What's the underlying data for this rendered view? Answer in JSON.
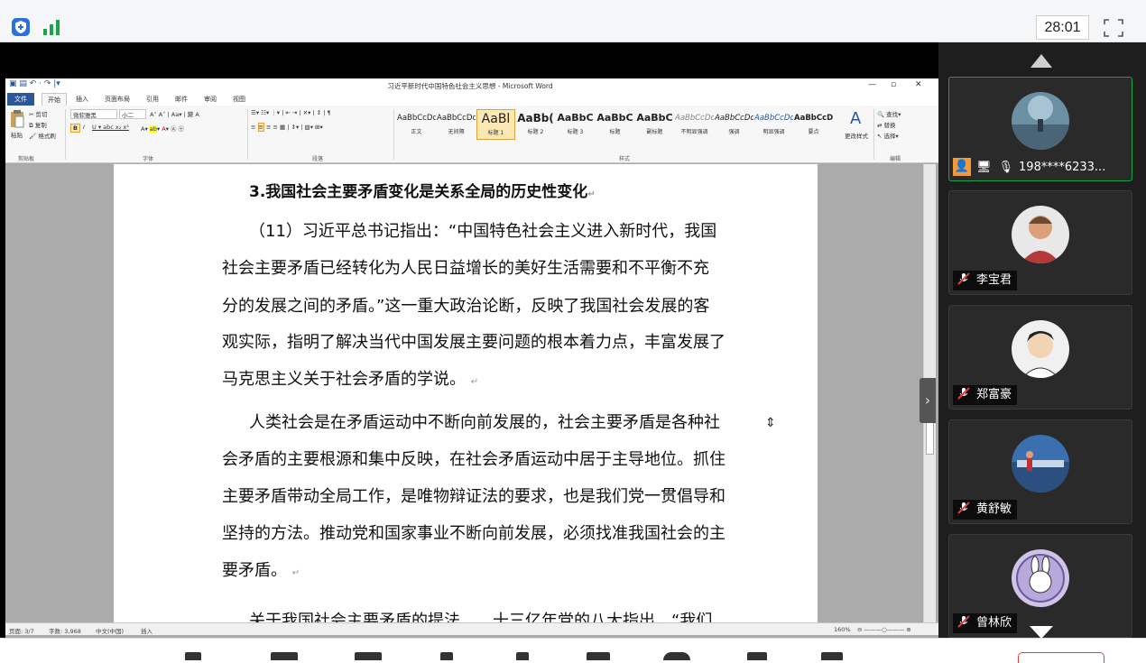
{
  "meeting": {
    "timer": "28:01",
    "icons": {
      "security": "shield-icon",
      "network": "signal-bars-icon",
      "fullscreen": "fullscreen-icon"
    }
  },
  "word": {
    "title": "习近平新时代中国特色社会主义思想 - Microsoft Word",
    "tabs": [
      "文件",
      "开始",
      "插入",
      "页面布局",
      "引用",
      "邮件",
      "审阅",
      "视图"
    ],
    "clipboard": {
      "paste": "粘贴",
      "cut": "剪切",
      "copy": "复制",
      "format_painter": "格式刷",
      "group": "剪贴板"
    },
    "font": {
      "name": "微软雅黑",
      "size": "小二",
      "group": "字体"
    },
    "paragraph": {
      "group": "段落"
    },
    "styles": {
      "group": "样式",
      "items": [
        {
          "preview": "AaBbCcDd",
          "name": "正文"
        },
        {
          "preview": "AaBbCcDd",
          "name": "无间隔"
        },
        {
          "preview": "AaBl",
          "name": "标题 1"
        },
        {
          "preview": "AaBb(",
          "name": "标题 2"
        },
        {
          "preview": "AaBbC",
          "name": "标题 3"
        },
        {
          "preview": "AaBbC",
          "name": "标题"
        },
        {
          "preview": "AaBbC",
          "name": "副标题"
        },
        {
          "preview": "AaBbCcDd",
          "name": "不明显强调"
        },
        {
          "preview": "AaBbCcDd",
          "name": "强调"
        },
        {
          "preview": "AaBbCcDd",
          "name": "明显强调"
        },
        {
          "preview": "AaBbCcDd",
          "name": "要点"
        }
      ],
      "change": "更改样式"
    },
    "editing": {
      "find": "查找",
      "replace": "替换",
      "select": "选择",
      "group": "编辑"
    },
    "document": {
      "heading": "3.我国社会主要矛盾变化是关系全局的历史性变化",
      "lines": [
        "（11）习近平总书记指出：“中国特色社会主义进入新时代，我国",
        "社会主要矛盾已经转化为人民日益增长的美好生活需要和不平衡不充",
        "分的发展之间的矛盾。”这一重大政治论断，反映了我国社会发展的客",
        "观实际，指明了解决当代中国发展主要问题的根本着力点，丰富发展了",
        "马克思主义关于社会矛盾的学说。",
        "人类社会是在矛盾运动中不断向前发展的，社会主要矛盾是各种社",
        "会矛盾的主要根源和集中反映，在社会矛盾运动中居于主导地位。抓住",
        "主要矛盾带动全局工作，是唯物辩证法的要求，也是我们党一贯倡导和",
        "坚持的方法。推动党和国家事业不断向前发展，必须找准我国社会的主",
        "要矛盾。",
        "关于我国社会主要矛盾的提法……十三亿年党的八大指出，“我们"
      ],
      "paragraph_mark": "↵"
    },
    "status": {
      "page": "页面: 3/7",
      "words": "字数: 3,968",
      "lang": "中文(中国)",
      "mode": "插入",
      "zoom": "160%"
    }
  },
  "participants": [
    {
      "name": "198****6233...",
      "active": true
    },
    {
      "name": "李宝君",
      "active": false
    },
    {
      "name": "郑富豪",
      "active": false
    },
    {
      "name": "黄舒敏",
      "active": false
    },
    {
      "name": "曾林欣",
      "active": false
    }
  ]
}
